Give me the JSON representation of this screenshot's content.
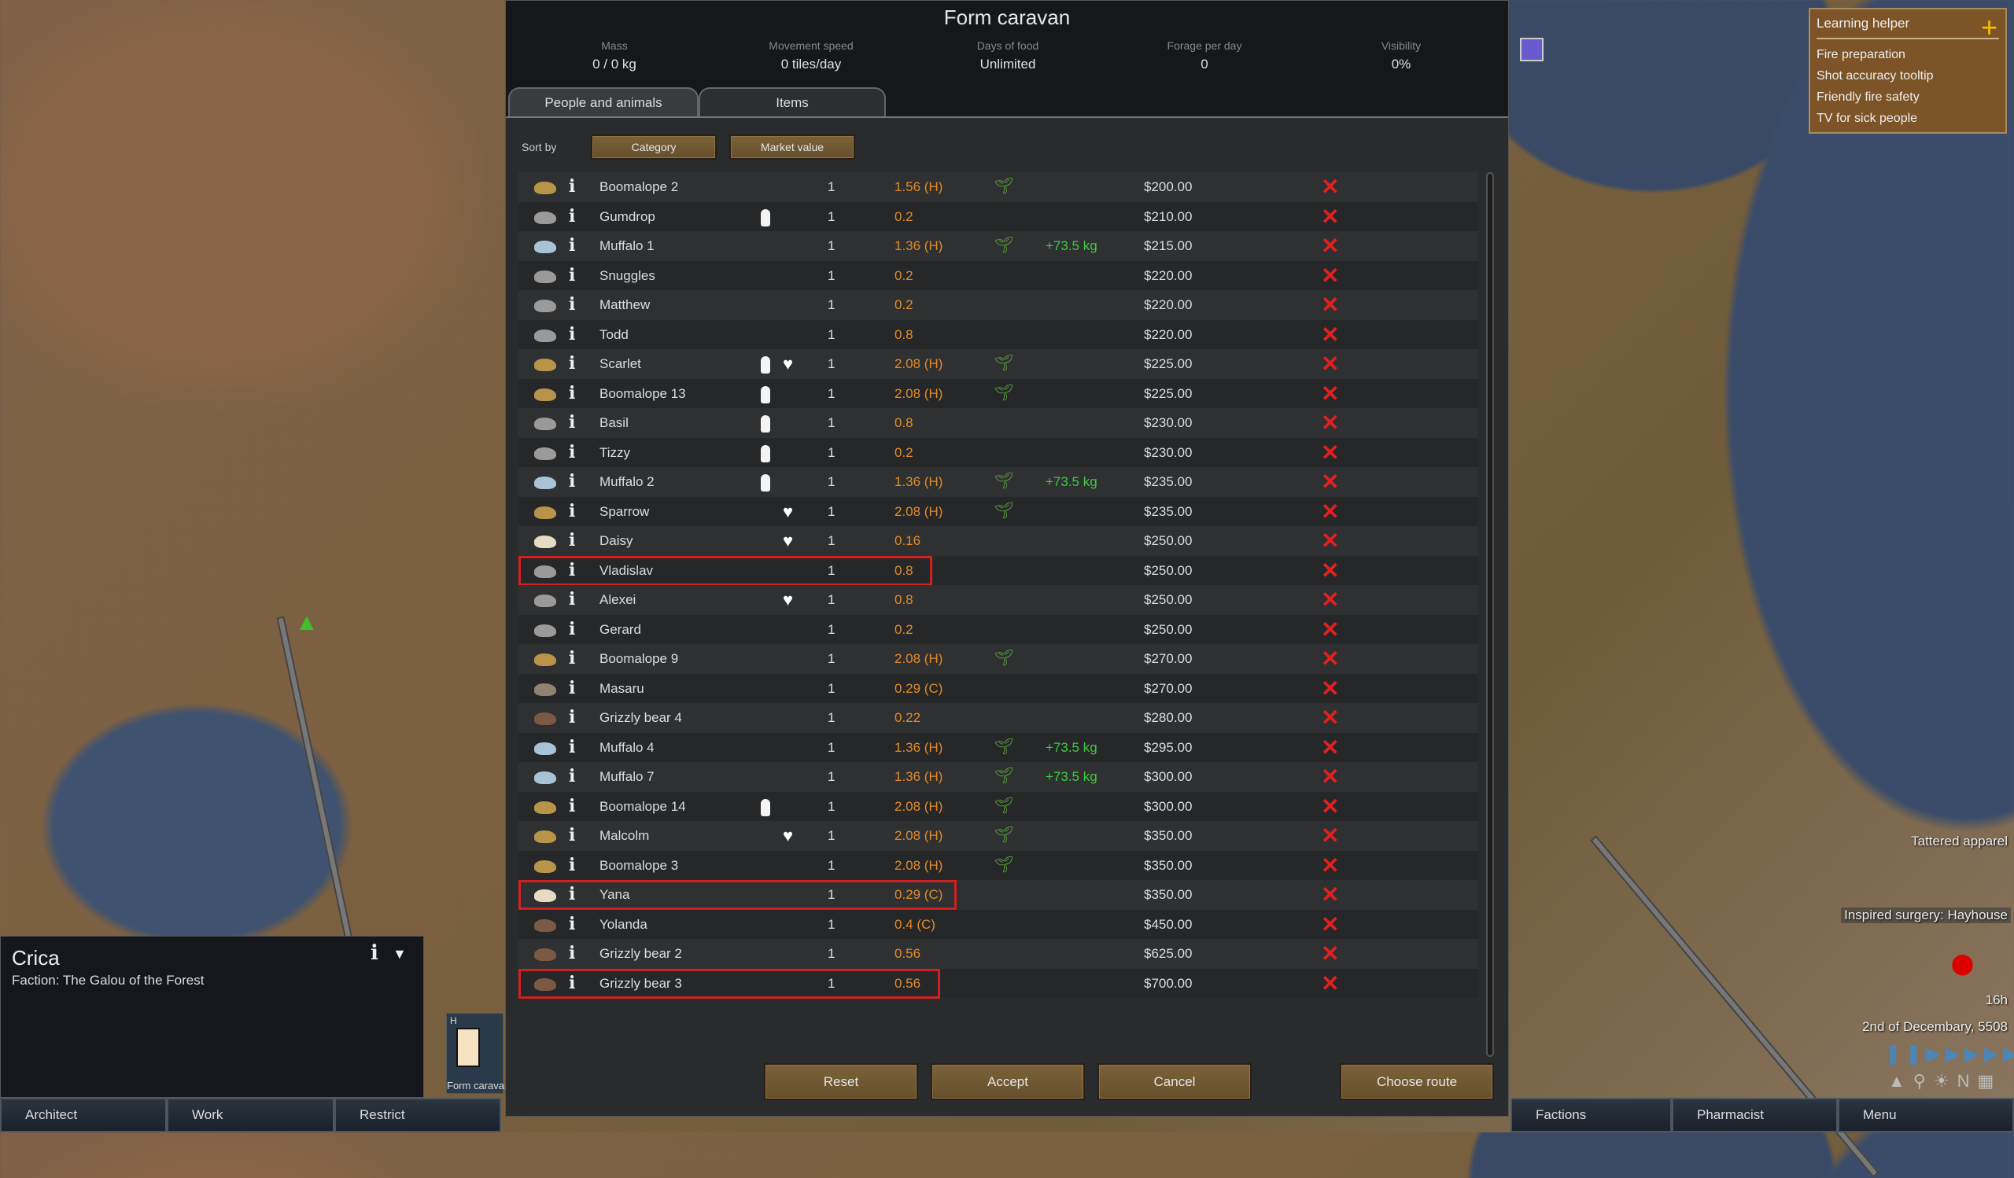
{
  "dialog": {
    "title": "Form caravan",
    "stats": [
      {
        "label": "Mass",
        "value": "0 / 0 kg"
      },
      {
        "label": "Movement speed",
        "value": "0 tiles/day"
      },
      {
        "label": "Days of food",
        "value": "Unlimited"
      },
      {
        "label": "Forage per day",
        "value": "0"
      },
      {
        "label": "Visibility",
        "value": "0%"
      }
    ],
    "tabs": [
      {
        "label": "People and animals",
        "active": true
      },
      {
        "label": "Items",
        "active": false
      }
    ],
    "sort_label": "Sort by",
    "sort_buttons": [
      "Category",
      "Market value"
    ],
    "buttons": {
      "reset": "Reset",
      "accept": "Accept",
      "cancel": "Cancel",
      "choose_route": "Choose route"
    },
    "colors": {
      "carry": "#e08a2a",
      "kg": "#3fca3f",
      "remove": "#e32020",
      "highlight": "#d02020"
    },
    "rows": [
      {
        "name": "Boomalope 2",
        "icon": "boomalope-icon",
        "trained": false,
        "bonded": false,
        "count": "1",
        "carry": "1.56 (H)",
        "plant": true,
        "kg": "",
        "value": "$200.00"
      },
      {
        "name": "Gumdrop",
        "icon": "dog-icon",
        "trained": true,
        "bonded": false,
        "count": "1",
        "carry": "0.2",
        "plant": false,
        "kg": "",
        "value": "$210.00"
      },
      {
        "name": "Muffalo 1",
        "icon": "muffalo-icon",
        "trained": false,
        "bonded": false,
        "count": "1",
        "carry": "1.36 (H)",
        "plant": true,
        "kg": "+73.5 kg",
        "value": "$215.00"
      },
      {
        "name": "Snuggles",
        "icon": "dog-icon",
        "trained": false,
        "bonded": false,
        "count": "1",
        "carry": "0.2",
        "plant": false,
        "kg": "",
        "value": "$220.00"
      },
      {
        "name": "Matthew",
        "icon": "dog-icon",
        "trained": false,
        "bonded": false,
        "count": "1",
        "carry": "0.2",
        "plant": false,
        "kg": "",
        "value": "$220.00"
      },
      {
        "name": "Todd",
        "icon": "dog-icon",
        "trained": false,
        "bonded": false,
        "count": "1",
        "carry": "0.8",
        "plant": false,
        "kg": "",
        "value": "$220.00"
      },
      {
        "name": "Scarlet",
        "icon": "boomalope-icon",
        "trained": true,
        "bonded": true,
        "count": "1",
        "carry": "2.08 (H)",
        "plant": true,
        "kg": "",
        "value": "$225.00"
      },
      {
        "name": "Boomalope 13",
        "icon": "boomalope-icon",
        "trained": true,
        "bonded": false,
        "count": "1",
        "carry": "2.08 (H)",
        "plant": true,
        "kg": "",
        "value": "$225.00"
      },
      {
        "name": "Basil",
        "icon": "dog-icon",
        "trained": true,
        "bonded": false,
        "count": "1",
        "carry": "0.8",
        "plant": false,
        "kg": "",
        "value": "$230.00"
      },
      {
        "name": "Tizzy",
        "icon": "dog-icon",
        "trained": true,
        "bonded": false,
        "count": "1",
        "carry": "0.2",
        "plant": false,
        "kg": "",
        "value": "$230.00"
      },
      {
        "name": "Muffalo 2",
        "icon": "muffalo-icon",
        "trained": true,
        "bonded": false,
        "count": "1",
        "carry": "1.36 (H)",
        "plant": true,
        "kg": "+73.5 kg",
        "value": "$235.00"
      },
      {
        "name": "Sparrow",
        "icon": "boomalope-icon",
        "trained": false,
        "bonded": true,
        "count": "1",
        "carry": "2.08 (H)",
        "plant": true,
        "kg": "",
        "value": "$235.00"
      },
      {
        "name": "Daisy",
        "icon": "horse-icon",
        "trained": false,
        "bonded": true,
        "count": "1",
        "carry": "0.16",
        "plant": false,
        "kg": "",
        "value": "$250.00"
      },
      {
        "name": "Vladislav",
        "icon": "dog-icon",
        "trained": false,
        "bonded": false,
        "count": "1",
        "carry": "0.8",
        "plant": false,
        "kg": "",
        "value": "$250.00",
        "highlight": true
      },
      {
        "name": "Alexei",
        "icon": "dog-icon",
        "trained": false,
        "bonded": true,
        "count": "1",
        "carry": "0.8",
        "plant": false,
        "kg": "",
        "value": "$250.00"
      },
      {
        "name": "Gerard",
        "icon": "dog-icon",
        "trained": false,
        "bonded": false,
        "count": "1",
        "carry": "0.2",
        "plant": false,
        "kg": "",
        "value": "$250.00"
      },
      {
        "name": "Boomalope 9",
        "icon": "boomalope-icon",
        "trained": false,
        "bonded": false,
        "count": "1",
        "carry": "2.08 (H)",
        "plant": true,
        "kg": "",
        "value": "$270.00"
      },
      {
        "name": "Masaru",
        "icon": "fox-icon",
        "trained": false,
        "bonded": false,
        "count": "1",
        "carry": "0.29 (C)",
        "plant": false,
        "kg": "",
        "value": "$270.00"
      },
      {
        "name": "Grizzly bear 4",
        "icon": "bear-icon",
        "trained": false,
        "bonded": false,
        "count": "1",
        "carry": "0.22",
        "plant": false,
        "kg": "",
        "value": "$280.00"
      },
      {
        "name": "Muffalo 4",
        "icon": "muffalo-icon",
        "trained": false,
        "bonded": false,
        "count": "1",
        "carry": "1.36 (H)",
        "plant": true,
        "kg": "+73.5 kg",
        "value": "$295.00"
      },
      {
        "name": "Muffalo 7",
        "icon": "muffalo-icon",
        "trained": false,
        "bonded": false,
        "count": "1",
        "carry": "1.36 (H)",
        "plant": true,
        "kg": "+73.5 kg",
        "value": "$300.00"
      },
      {
        "name": "Boomalope 14",
        "icon": "boomalope-icon",
        "trained": true,
        "bonded": false,
        "count": "1",
        "carry": "2.08 (H)",
        "plant": true,
        "kg": "",
        "value": "$300.00"
      },
      {
        "name": "Malcolm",
        "icon": "boomalope-icon",
        "trained": false,
        "bonded": true,
        "count": "1",
        "carry": "2.08 (H)",
        "plant": true,
        "kg": "",
        "value": "$350.00"
      },
      {
        "name": "Boomalope 3",
        "icon": "boomalope-icon",
        "trained": false,
        "bonded": false,
        "count": "1",
        "carry": "2.08 (H)",
        "plant": true,
        "kg": "",
        "value": "$350.00"
      },
      {
        "name": "Yana",
        "icon": "horse-icon",
        "trained": false,
        "bonded": false,
        "count": "1",
        "carry": "0.29 (C)",
        "plant": false,
        "kg": "",
        "value": "$350.00",
        "highlight": true
      },
      {
        "name": "Yolanda",
        "icon": "bear-icon",
        "trained": false,
        "bonded": false,
        "count": "1",
        "carry": "0.4 (C)",
        "plant": false,
        "kg": "",
        "value": "$450.00"
      },
      {
        "name": "Grizzly bear 2",
        "icon": "bear-icon",
        "trained": false,
        "bonded": false,
        "count": "1",
        "carry": "0.56",
        "plant": false,
        "kg": "",
        "value": "$625.00"
      },
      {
        "name": "Grizzly bear 3",
        "icon": "bear-icon",
        "trained": false,
        "bonded": false,
        "count": "1",
        "carry": "0.56",
        "plant": false,
        "kg": "",
        "value": "$700.00",
        "highlight": true
      }
    ]
  },
  "learning_helper": {
    "title": "Learning helper",
    "items": [
      "Fire preparation",
      "Shot accuracy tooltip",
      "Friendly fire safety",
      "TV for sick people"
    ]
  },
  "selection": {
    "name": "Crica",
    "faction": "Faction: The Galou of the Forest",
    "gizmo_hotkey": "H",
    "gizmo_label": "Form caravan"
  },
  "map": {
    "alert1": "Tattered apparel",
    "alert2": "Inspired surgery: Hayhouse",
    "time": "16h",
    "date": "2nd of Decembary, 5508"
  },
  "bottom_bar": {
    "left": [
      "Architect",
      "Work",
      "Restrict"
    ],
    "right": [
      "Factions",
      "Pharmacist",
      "Menu"
    ]
  }
}
